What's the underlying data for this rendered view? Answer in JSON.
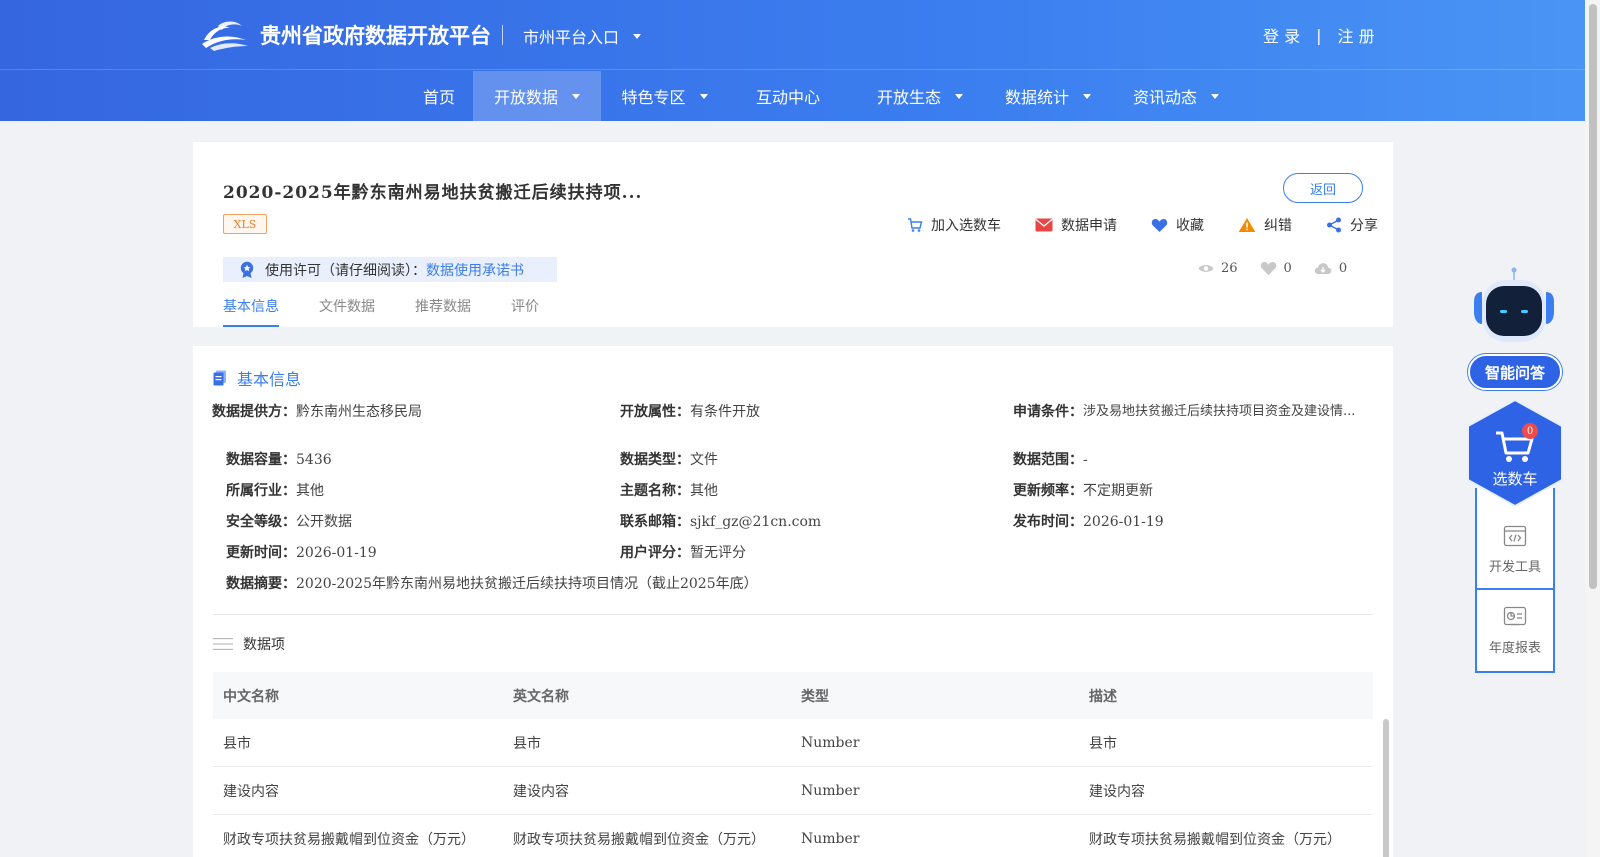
{
  "header": {
    "site_title": "贵州省政府数据开放平台",
    "city_entry": "市州平台入口",
    "login": "登 录",
    "separator": "|",
    "register": "注 册"
  },
  "nav": {
    "items": [
      {
        "label": "首页",
        "dropdown": false
      },
      {
        "label": "开放数据",
        "dropdown": true,
        "active": true
      },
      {
        "label": "特色专区",
        "dropdown": true
      },
      {
        "label": "互动中心",
        "dropdown": false
      },
      {
        "label": "开放生态",
        "dropdown": true
      },
      {
        "label": "数据统计",
        "dropdown": true
      },
      {
        "label": "资讯动态",
        "dropdown": true
      }
    ]
  },
  "dataset": {
    "title": "2020-2025年黔东南州易地扶贫搬迁后续扶持项...",
    "format_badge": "XLS",
    "back_label": "返回",
    "actions": [
      {
        "label": "加入选数车",
        "icon": "cart-icon"
      },
      {
        "label": "数据申请",
        "icon": "mail-icon"
      },
      {
        "label": "收藏",
        "icon": "heart-icon"
      },
      {
        "label": "纠错",
        "icon": "warning-icon"
      },
      {
        "label": "分享",
        "icon": "share-icon"
      }
    ],
    "license_label": "使用许可（请仔细阅读）：",
    "license_link": "数据使用承诺书",
    "stats": {
      "views": "26",
      "likes": "0",
      "downloads": "0"
    },
    "tabs": [
      {
        "label": "基本信息",
        "active": true
      },
      {
        "label": "文件数据"
      },
      {
        "label": "推荐数据"
      },
      {
        "label": "评价"
      }
    ]
  },
  "basic_info": {
    "section_title": "基本信息",
    "fields": {
      "provider": {
        "k": "数据提供方：",
        "v": "黔东南州生态移民局"
      },
      "open_attr": {
        "k": "开放属性：",
        "v": "有条件开放"
      },
      "apply_cond": {
        "k": "申请条件：",
        "v": "涉及易地扶贫搬迁后续扶持项目资金及建设情..."
      },
      "capacity": {
        "k": "数据容量：",
        "v": "5436"
      },
      "data_type": {
        "k": "数据类型：",
        "v": "文件"
      },
      "data_range": {
        "k": "数据范围：",
        "v": "-"
      },
      "industry": {
        "k": "所属行业：",
        "v": "其他"
      },
      "topic": {
        "k": "主题名称：",
        "v": "其他"
      },
      "frequency": {
        "k": "更新频率：",
        "v": "不定期更新"
      },
      "security": {
        "k": "安全等级：",
        "v": "公开数据"
      },
      "email": {
        "k": "联系邮箱：",
        "v": "sjkf_gz@21cn.com"
      },
      "publish_time": {
        "k": "发布时间：",
        "v": "2026-01-19"
      },
      "update_time": {
        "k": "更新时间：",
        "v": "2026-01-19"
      },
      "rating": {
        "k": "用户评分：",
        "v": "暂无评分"
      },
      "summary": {
        "k": "数据摘要：",
        "v": "2020-2025年黔东南州易地扶贫搬迁后续扶持项目情况（截止2025年底）"
      }
    }
  },
  "data_items": {
    "title": "数据项",
    "columns": [
      "中文名称",
      "英文名称",
      "类型",
      "描述"
    ],
    "rows": [
      [
        "县市",
        "县市",
        "Number",
        "县市"
      ],
      [
        "建设内容",
        "建设内容",
        "Number",
        "建设内容"
      ],
      [
        "财政专项扶贫易搬戴帽到位资金（万元）",
        "财政专项扶贫易搬戴帽到位资金（万元）",
        "Number",
        "财政专项扶贫易搬戴帽到位资金（万元）"
      ]
    ]
  },
  "widgets": {
    "ask_label": "智能问答",
    "cart_label": "选数车",
    "cart_count": "0",
    "dev_tools": "开发工具",
    "annual_report": "年度报表"
  },
  "colors": {
    "primary": "#3b7ef0",
    "header_start": "#3566e0",
    "badge_orange": "#f08030",
    "mail_red": "#e84545",
    "warning_orange": "#f08c00"
  }
}
